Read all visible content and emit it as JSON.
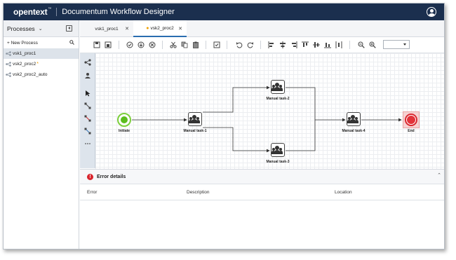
{
  "header": {
    "brand": "opentext",
    "brand_tm": "™",
    "title": "Documentum Workflow Designer",
    "user_icon": "user-avatar-icon"
  },
  "sidebar": {
    "title": "Processes",
    "new_process_label": "+ New Process",
    "items": [
      {
        "label": "vsk1_proc1",
        "active": true
      },
      {
        "label": "vsk2_proc2",
        "modified": true,
        "mod_mark": "*"
      },
      {
        "label": "vsk2_proc2_auto"
      }
    ]
  },
  "tabs": [
    {
      "label": "vsk1_proc1",
      "active": false
    },
    {
      "label": "vsk2_proc2",
      "active": true,
      "mod_mark": "●"
    }
  ],
  "toolbar": {
    "zoom_value": "",
    "icons": [
      "save-icon",
      "save-as-icon",
      "validate-icon",
      "install-icon",
      "uninstall-icon",
      "cut-icon",
      "copy-icon",
      "paste-icon",
      "properties-icon",
      "undo-icon",
      "redo-icon",
      "align-left-icon",
      "align-center-icon",
      "align-right-icon",
      "align-top-icon",
      "align-middle-icon",
      "align-bottom-icon",
      "distribute-icon",
      "zoom-out-icon",
      "zoom-in-icon"
    ]
  },
  "palette": {
    "icons": [
      "activities-icon",
      "participants-icon",
      "select-pointer-icon",
      "connect-flow-icon",
      "connect-reject-icon",
      "connect-link-icon",
      "more-icon"
    ]
  },
  "workflow": {
    "nodes": [
      {
        "id": "initiate",
        "label": "Initiate",
        "kind": "start"
      },
      {
        "id": "t1",
        "label": "Manual task-1",
        "kind": "task"
      },
      {
        "id": "t2",
        "label": "Manual task-2",
        "kind": "task"
      },
      {
        "id": "t3",
        "label": "Manual task-3",
        "kind": "task"
      },
      {
        "id": "t4",
        "label": "Manual task-4",
        "kind": "task"
      },
      {
        "id": "end",
        "label": "End",
        "kind": "end"
      }
    ]
  },
  "error_panel": {
    "title": "Error details",
    "columns": [
      "Error",
      "Description",
      "Location"
    ],
    "colors": {
      "error": "#d9262e"
    }
  },
  "colors": {
    "header_bg": "#1b2f4e",
    "start": "#5bbd1e",
    "end": "#e2333a",
    "modified": "#f0a000"
  }
}
